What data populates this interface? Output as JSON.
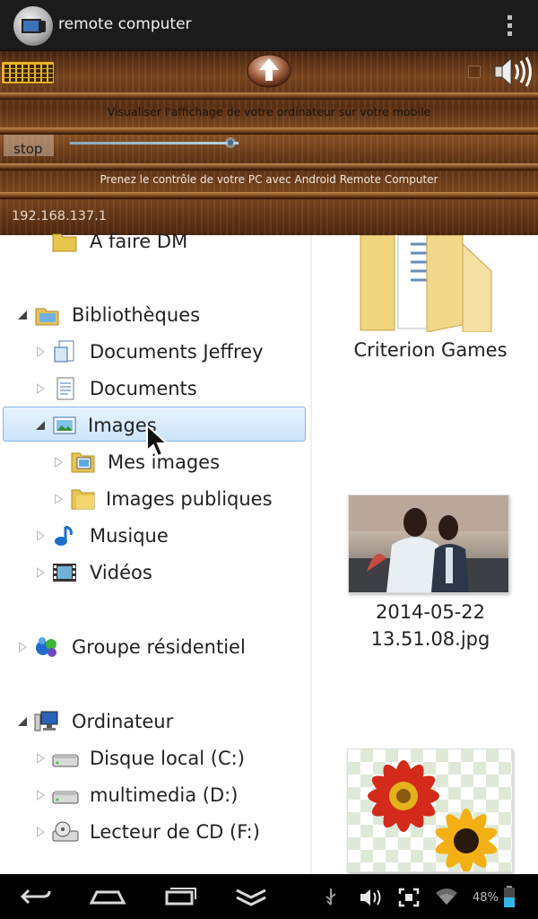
{
  "app": {
    "title": "remote computer"
  },
  "panel": {
    "text_visualiser": "Visualiser l'affichage de votre ordinateur sur votre mobile",
    "stop_label": "stop",
    "text_control": "Prenez le contrôle de votre PC avec Android Remote Computer",
    "ip_address": "192.168.137.1",
    "quality_slider_fraction": 0.95
  },
  "explorer": {
    "tree": [
      {
        "label": "A faire DM",
        "expand": "none",
        "icon": "folder-icon"
      },
      {
        "label": "Bibliothèques",
        "expand": "expanded",
        "icon": "libraries-icon"
      },
      {
        "label": "Documents Jeffrey",
        "expand": "collapsed",
        "icon": "documents-library-icon"
      },
      {
        "label": "Documents",
        "expand": "collapsed",
        "icon": "document-icon"
      },
      {
        "label": "Images",
        "expand": "expanded",
        "icon": "images-library-icon",
        "selected": true
      },
      {
        "label": "Mes images",
        "expand": "collapsed",
        "icon": "pictures-folder-icon"
      },
      {
        "label": "Images publiques",
        "expand": "collapsed",
        "icon": "folder-icon"
      },
      {
        "label": "Musique",
        "expand": "collapsed",
        "icon": "music-icon"
      },
      {
        "label": "Vidéos",
        "expand": "collapsed",
        "icon": "videos-icon"
      },
      {
        "label": "Groupe résidentiel",
        "expand": "collapsed",
        "icon": "homegroup-icon"
      },
      {
        "label": "Ordinateur",
        "expand": "expanded",
        "icon": "computer-icon"
      },
      {
        "label": "Disque local (C:)",
        "expand": "collapsed",
        "icon": "drive-icon"
      },
      {
        "label": "multimedia (D:)",
        "expand": "collapsed",
        "icon": "drive-icon"
      },
      {
        "label": "Lecteur de CD (F:)",
        "expand": "collapsed",
        "icon": "cd-drive-icon"
      }
    ],
    "items": [
      {
        "label": "Criterion Games",
        "kind": "folder"
      },
      {
        "label_line1": "2014-05-22",
        "label_line2": "13.51.08.jpg",
        "kind": "photo"
      },
      {
        "label": "",
        "kind": "image"
      }
    ]
  },
  "statusbar": {
    "battery": "48%"
  },
  "colors": {
    "actionbar": "#1b1b1b",
    "selection": "#cce4fa",
    "selection_border": "#85b6e3",
    "battery_fill": "#33b5e5"
  }
}
